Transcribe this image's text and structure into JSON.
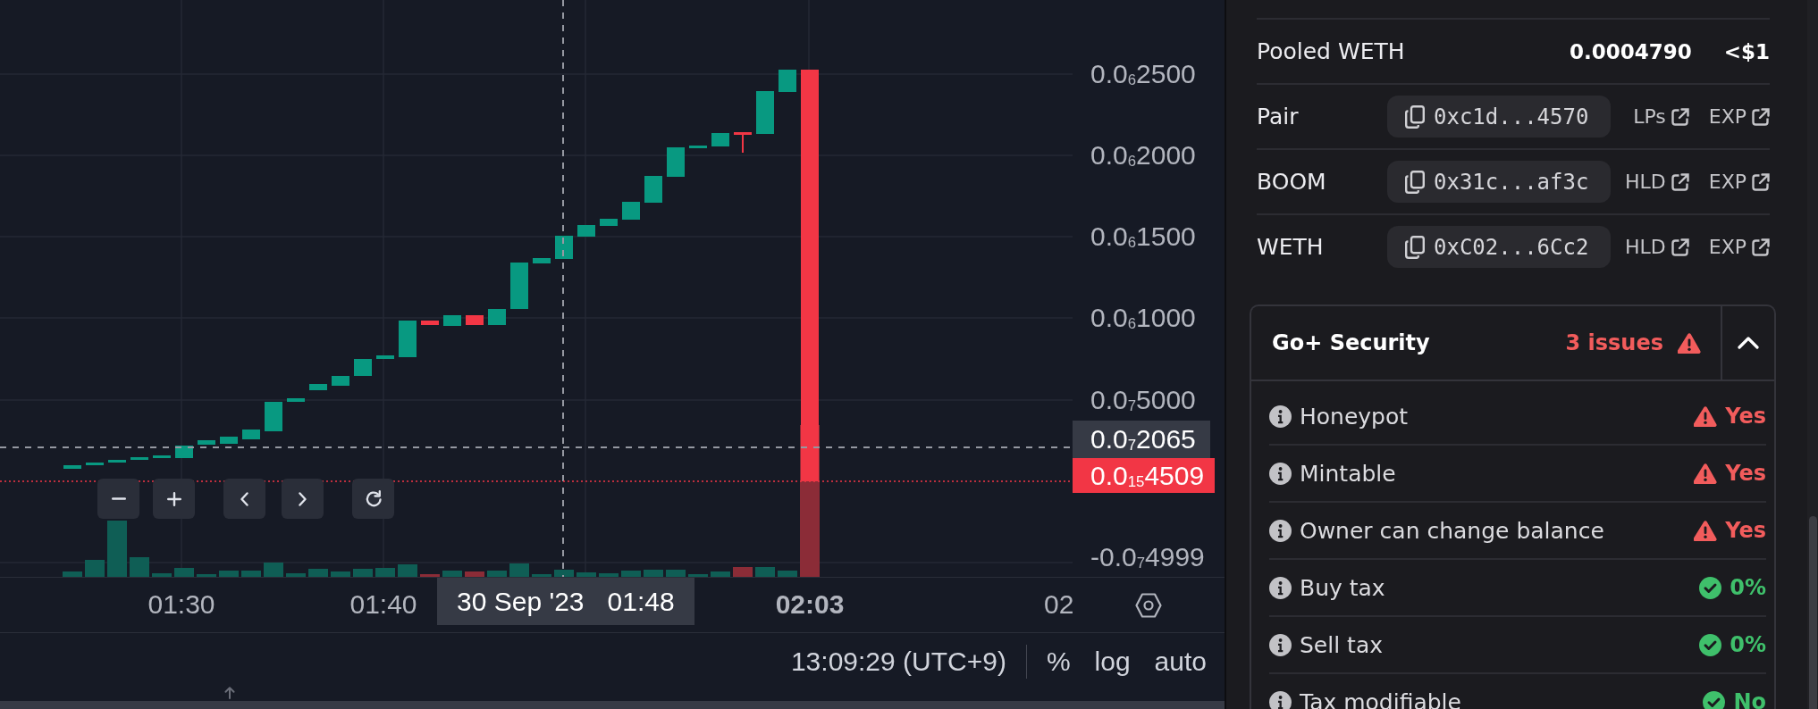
{
  "chart": {
    "price_axis": {
      "labels": [
        "0.0$_{6}$2500",
        "0.0$_{6}$2000",
        "0.0$_{6}$1500",
        "0.0$_{6}$1000",
        "0.0$_{7}$5000",
        "-0.0$_{7}$4999"
      ]
    },
    "crosshair": {
      "price": "0.0$_{7}$2065",
      "date": "30 Sep '23",
      "time": "01:48"
    },
    "last_price": "0.0$_{15}$4509",
    "time_axis": {
      "labels": [
        {
          "text": "01:30",
          "major": false
        },
        {
          "text": "01:40",
          "major": false
        },
        {
          "text": "02:03",
          "major": true
        },
        {
          "text": "02",
          "major": false
        }
      ]
    }
  },
  "status_bar": {
    "clock": "13:09:29 (UTC+9)",
    "options": [
      "%",
      "log",
      "auto"
    ]
  },
  "token_info": {
    "pooled": {
      "label": "Pooled WETH",
      "amount": "0.0004790",
      "usd": "<$1"
    },
    "addresses": [
      {
        "label": "Pair",
        "address": "0xc1d...4570",
        "links": [
          "LPs",
          "EXP"
        ]
      },
      {
        "label": "BOOM",
        "address": "0x31c...af3c",
        "links": [
          "HLD",
          "EXP"
        ]
      },
      {
        "label": "WETH",
        "address": "0xC02...6Cc2",
        "links": [
          "HLD",
          "EXP"
        ]
      }
    ]
  },
  "security": {
    "title": "Go+ Security",
    "summary": {
      "text": "3 issues",
      "kind": "risk"
    },
    "expanded": true,
    "checks": [
      {
        "label": "Honeypot",
        "value": "Yes",
        "kind": "risk"
      },
      {
        "label": "Mintable",
        "value": "Yes",
        "kind": "risk"
      },
      {
        "label": "Owner can change balance",
        "value": "Yes",
        "kind": "risk"
      },
      {
        "label": "Buy tax",
        "value": "0%",
        "kind": "safe"
      },
      {
        "label": "Sell tax",
        "value": "0%",
        "kind": "safe"
      },
      {
        "label": "Tax modifiable",
        "value": "No",
        "kind": "safe"
      }
    ]
  }
}
